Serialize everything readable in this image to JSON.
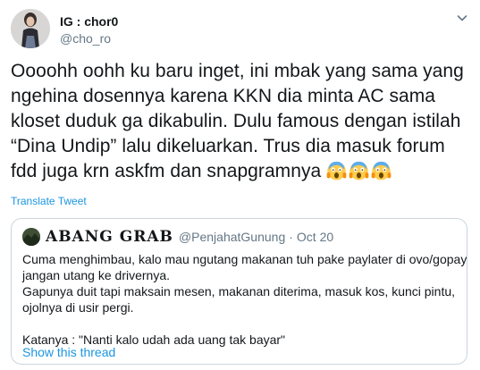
{
  "tweet": {
    "display_name": "IG : chor0",
    "handle": "@cho_ro",
    "text": "Oooohh oohh ku baru inget, ini mbak yang sama yang ngehina dosennya karena KKN dia minta AC sama kloset duduk ga dikabulin. Dulu famous dengan istilah “Dina Undip” lalu dikeluarkan. Trus dia masuk forum fdd juga krn askfm dan snapgramnya",
    "emoji_icons": [
      "face-screaming-in-fear-icon",
      "face-screaming-in-fear-icon",
      "face-screaming-in-fear-icon"
    ],
    "translate_label": "Translate Tweet"
  },
  "quoted_tweet": {
    "display_name": "ABANG GRAB",
    "handle": "@PenjahatGunung",
    "separator": "·",
    "date": "Oct 20",
    "lines": [
      "Cuma menghimbau, kalo mau ngutang makanan tuh pake paylater di ovo/gopay,",
      "jangan utang ke drivernya.",
      "Gapunya duit tapi maksain mesen, makanan diterima, masuk kos, kunci pintu,",
      "ojolnya di usir pergi.",
      "",
      "Katanya : \"Nanti kalo udah ada uang tak bayar\""
    ],
    "show_thread_label": "Show this thread"
  },
  "colors": {
    "link": "#1b95e0",
    "secondary_text": "#657786",
    "border": "#ccd6dd"
  }
}
